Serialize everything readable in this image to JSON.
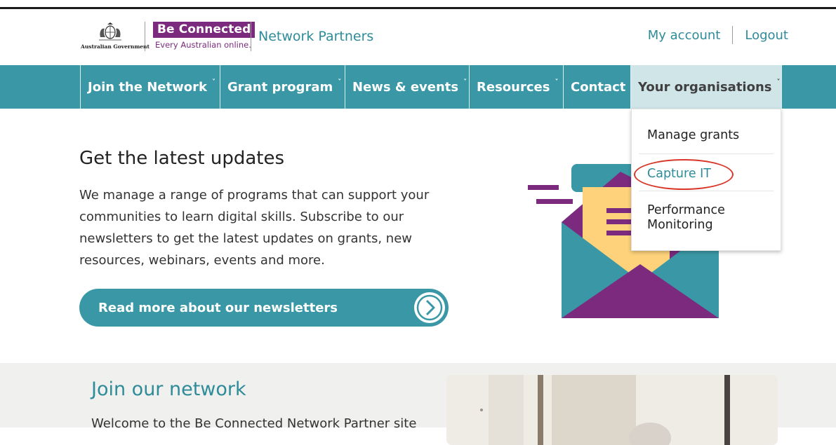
{
  "header": {
    "gov_logo_text": "Australian Government",
    "brand_name": "Be Connected",
    "brand_tagline": "Every Australian online.",
    "site_title": "Network Partners",
    "my_account": "My account",
    "logout": "Logout"
  },
  "nav": {
    "items": [
      {
        "label": "Join the Network",
        "has_dropdown": true
      },
      {
        "label": "Grant program",
        "has_dropdown": true
      },
      {
        "label": "News & events",
        "has_dropdown": true
      },
      {
        "label": "Resources",
        "has_dropdown": true
      },
      {
        "label": "Contact",
        "has_dropdown": false
      },
      {
        "label": "Your organisations",
        "has_dropdown": true,
        "active": true
      }
    ],
    "caret": "˅"
  },
  "dropdown": {
    "items": [
      {
        "label": "Manage grants"
      },
      {
        "label": "Capture IT",
        "highlighted": true
      },
      {
        "label_line1": "Performance",
        "label_line2": "Monitoring"
      }
    ]
  },
  "hero": {
    "title": "Get the latest updates",
    "body": "We manage a range of programs that can support your communities to learn digital skills. Subscribe to our newsletters to get the latest updates on grants, new resources, webinars, events and more.",
    "cta_label": "Read more about our newsletters"
  },
  "join": {
    "title": "Join our network",
    "body": "Welcome to the Be Connected Network Partner site"
  },
  "colors": {
    "teal": "#3a98a6",
    "teal_text": "#2e8b98",
    "purple": "#7b2a7e",
    "highlight": "#d9362a"
  }
}
